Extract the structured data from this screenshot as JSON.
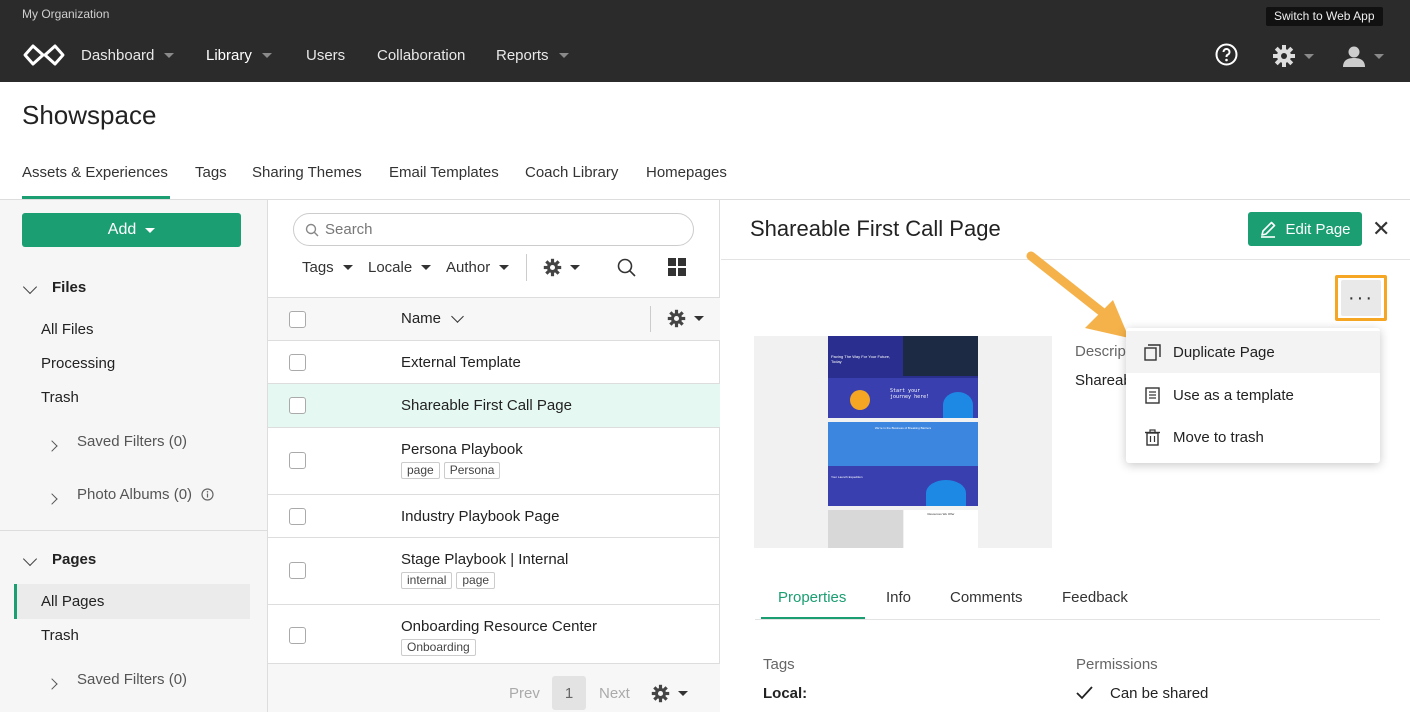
{
  "topbar": {
    "org": "My Organization",
    "switch_label": "Switch to Web App",
    "nav": [
      "Dashboard",
      "Library",
      "Users",
      "Collaboration",
      "Reports"
    ]
  },
  "page": {
    "title": "Showspace"
  },
  "tabs": [
    "Assets & Experiences",
    "Tags",
    "Sharing Themes",
    "Email Templates",
    "Coach Library",
    "Homepages"
  ],
  "sidebar": {
    "add_label": "Add",
    "files": {
      "title": "Files",
      "items": [
        "All Files",
        "Processing",
        "Trash"
      ],
      "saved_filters": "Saved Filters (0)",
      "photo_albums": "Photo Albums (0)"
    },
    "pages": {
      "title": "Pages",
      "items": [
        "All Pages",
        "Trash"
      ],
      "saved_filters": "Saved Filters (0)"
    }
  },
  "list": {
    "search_placeholder": "Search",
    "filters": [
      "Tags",
      "Locale",
      "Author"
    ],
    "column_name": "Name",
    "rows": [
      {
        "name": "External Template",
        "tags": []
      },
      {
        "name": "Shareable First Call Page",
        "tags": []
      },
      {
        "name": "Persona Playbook",
        "tags": [
          "page",
          "Persona"
        ]
      },
      {
        "name": "Industry Playbook Page",
        "tags": []
      },
      {
        "name": "Stage Playbook | Internal",
        "tags": [
          "internal",
          "page"
        ]
      },
      {
        "name": "Onboarding Resource Center",
        "tags": [
          "Onboarding"
        ]
      }
    ],
    "pagination": {
      "prev": "Prev",
      "page": "1",
      "next": "Next"
    }
  },
  "detail": {
    "title": "Shareable First Call Page",
    "edit_label": "Edit Page",
    "more_label": "···",
    "description_label": "Descrip",
    "description_value": "Shareab",
    "menu": [
      "Duplicate Page",
      "Use as a template",
      "Move to trash"
    ],
    "tabs": [
      "Properties",
      "Info",
      "Comments",
      "Feedback"
    ],
    "tags_label": "Tags",
    "local_label": "Local:",
    "permissions_label": "Permissions",
    "permission_value": "Can be shared"
  },
  "preview": {
    "headline": "Paving The Way For Your Future, Today",
    "cta": "Start your journey here!",
    "section2": "We're in the Business of Breaking Barriers",
    "section3": "Your Launch Expedition",
    "resource": "Resources We Offer"
  },
  "colors": {
    "accent": "#1a9e72",
    "highlight": "#f5a623",
    "topbar": "#2b2b2b",
    "selected_row": "#e6f8f2"
  }
}
